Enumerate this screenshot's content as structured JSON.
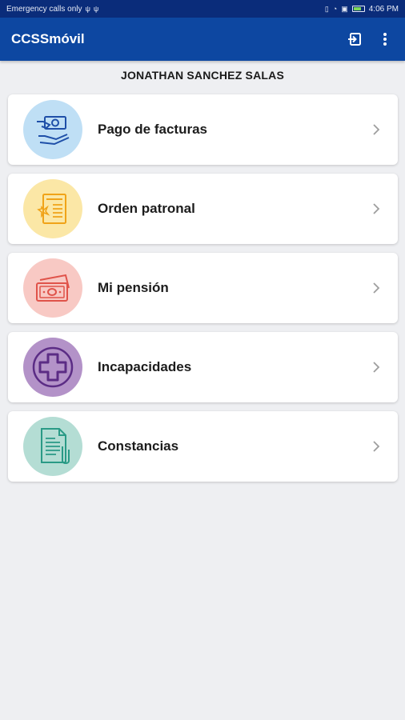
{
  "status_bar": {
    "carrier_text": "Emergency calls only",
    "time": "4:06 PM"
  },
  "app_bar": {
    "title": "CCSSmóvil",
    "logout_icon": "logout-icon",
    "overflow_icon": "more-vert-icon"
  },
  "user": {
    "name": "JONATHAN SANCHEZ SALAS"
  },
  "menu": {
    "items": [
      {
        "label": "Pago de facturas",
        "icon": "payment-hand-icon",
        "icon_bg": "#bfdff5",
        "icon_color": "#1e4fa8"
      },
      {
        "label": "Orden patronal",
        "icon": "document-star-icon",
        "icon_bg": "#fbe7a6",
        "icon_color": "#f0a318"
      },
      {
        "label": "Mi pensión",
        "icon": "money-bills-icon",
        "icon_bg": "#f8c9c4",
        "icon_color": "#e0534a"
      },
      {
        "label": "Incapacidades",
        "icon": "medical-cross-icon",
        "icon_bg": "#b392c8",
        "icon_color": "#5b2c85"
      },
      {
        "label": "Constancias",
        "icon": "document-clip-icon",
        "icon_bg": "#b4ddd4",
        "icon_color": "#2a9a86"
      }
    ]
  },
  "colors": {
    "status_bar": "#0a2c7a",
    "app_bar": "#0d47a1",
    "background": "#eeeff2"
  }
}
